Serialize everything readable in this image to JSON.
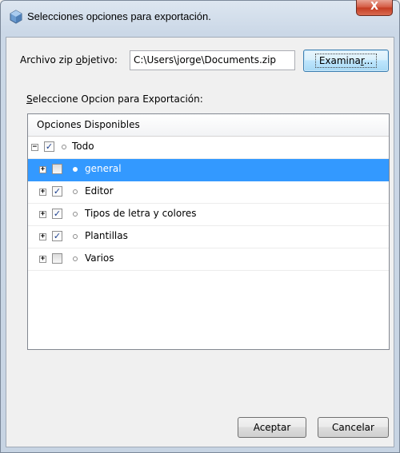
{
  "window": {
    "title": "Selecciones opciones para exportación.",
    "close_glyph": "X"
  },
  "file": {
    "label": "Archivo zip objetivo:",
    "value": "C:\\Users\\jorge\\Documents.zip",
    "browse_label": "Examinar..."
  },
  "select_label": "Seleccione Opcion para Exportación:",
  "tree": {
    "column_header": "Opciones Disponibles",
    "root": {
      "label": "Todo",
      "checked": true,
      "expanded": true
    },
    "children": [
      {
        "label": "general",
        "checked": false,
        "selected": true
      },
      {
        "label": "Editor",
        "checked": true,
        "selected": false
      },
      {
        "label": "Tipos de letra y colores",
        "checked": true,
        "selected": false
      },
      {
        "label": "Plantillas",
        "checked": true,
        "selected": false
      },
      {
        "label": "Varios",
        "checked": false,
        "selected": false
      }
    ]
  },
  "buttons": {
    "accept": "Aceptar",
    "cancel": "Cancelar"
  },
  "icons": {
    "app": "netbeans-cube-icon",
    "expand": "plus-box-icon",
    "collapse": "minus-box-icon",
    "node": "circle-node-icon"
  },
  "colors": {
    "selection": "#3399ff",
    "close_button": "#c43c22",
    "checkmark": "#1c3f8f"
  }
}
